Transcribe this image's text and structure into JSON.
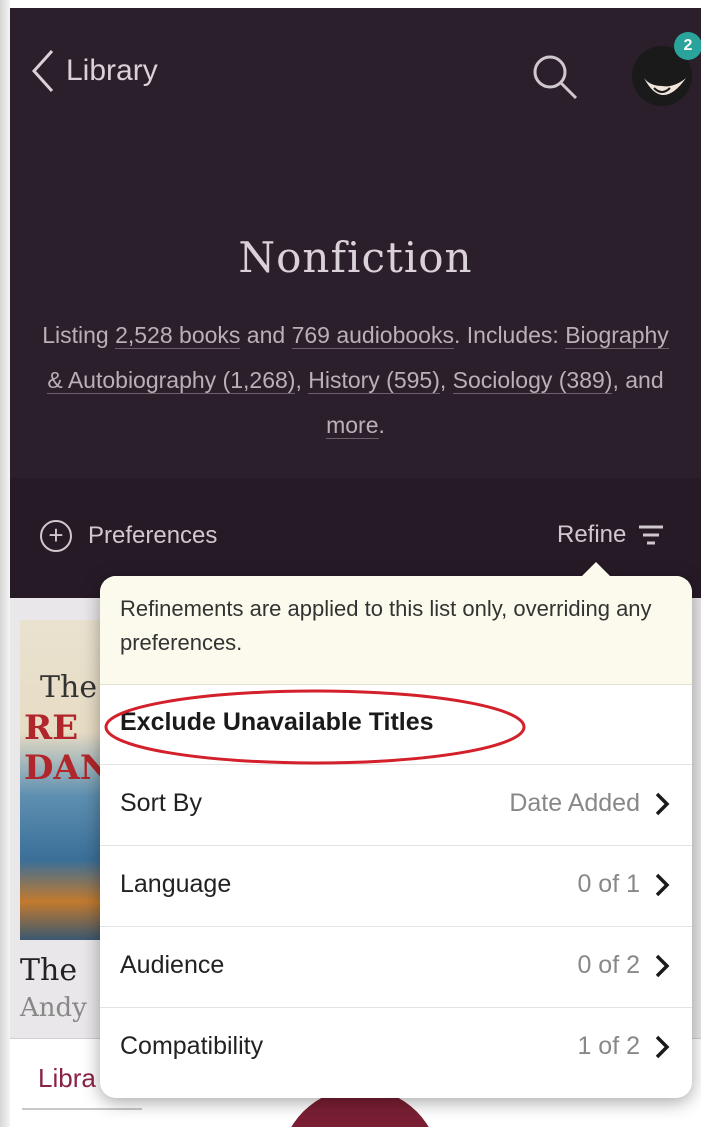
{
  "header": {
    "back_label": "Library",
    "notification_count": "2"
  },
  "hero": {
    "title": "Nonfiction",
    "description": {
      "prefix": "Listing ",
      "books": "2,528 books",
      "and1": " and ",
      "audiobooks": "769 audiobooks",
      "includes": ". Includes: ",
      "cat1": "Biography & Autobiography (1,268)",
      "comma1": ", ",
      "cat2": "History (595)",
      "comma2": ", ",
      "cat3": "Sociology (389)",
      "and2": ", and ",
      "more": "more",
      "end": "."
    }
  },
  "toolbar": {
    "preferences_label": "Preferences",
    "refine_label": "Refine"
  },
  "refine_popover": {
    "note": "Refinements are applied to this list only, overriding any preferences.",
    "exclude_label": "Exclude Unavailable Titles",
    "rows": [
      {
        "label": "Sort By",
        "value": "Date Added"
      },
      {
        "label": "Language",
        "value": "0 of 1"
      },
      {
        "label": "Audience",
        "value": "0 of 2"
      },
      {
        "label": "Compatibility",
        "value": "1 of 2"
      }
    ]
  },
  "background": {
    "book_cover_line1": "The",
    "book_cover_line2": "RE DAN",
    "book_title": "The",
    "book_author": "Andy",
    "bottom_tab": "Libra"
  },
  "colors": {
    "hero_bg": "#2c1f2c",
    "badge": "#2aa39a",
    "annotation": "#d3202a",
    "brand": "#8b2246"
  },
  "icons": {
    "back": "chevron-left-icon",
    "search": "search-icon",
    "avatar": "avatar-icon",
    "preferences": "plus-circle-icon",
    "refine": "filter-lines-icon",
    "row_chevron": "chevron-right-icon"
  }
}
